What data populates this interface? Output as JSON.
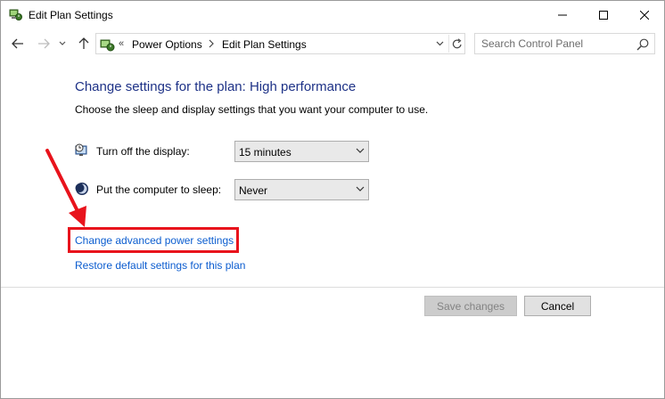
{
  "window": {
    "title": "Edit Plan Settings"
  },
  "address": {
    "prefix": "«",
    "crumbs": [
      "Power Options",
      "Edit Plan Settings"
    ]
  },
  "search": {
    "placeholder": "Search Control Panel"
  },
  "main": {
    "heading": "Change settings for the plan: High performance",
    "subheading": "Choose the sleep and display settings that you want your computer to use.",
    "settings": [
      {
        "label": "Turn off the display:",
        "value": "15 minutes",
        "icon": "monitor-clock-icon"
      },
      {
        "label": "Put the computer to sleep:",
        "value": "Never",
        "icon": "moon-sleep-icon"
      }
    ],
    "links": {
      "advanced": "Change advanced power settings",
      "restore": "Restore default settings for this plan"
    }
  },
  "buttons": {
    "save": "Save changes",
    "cancel": "Cancel"
  },
  "colors": {
    "heading": "#1e3287",
    "link": "#0b5ccf",
    "highlight": "#e8131c"
  }
}
